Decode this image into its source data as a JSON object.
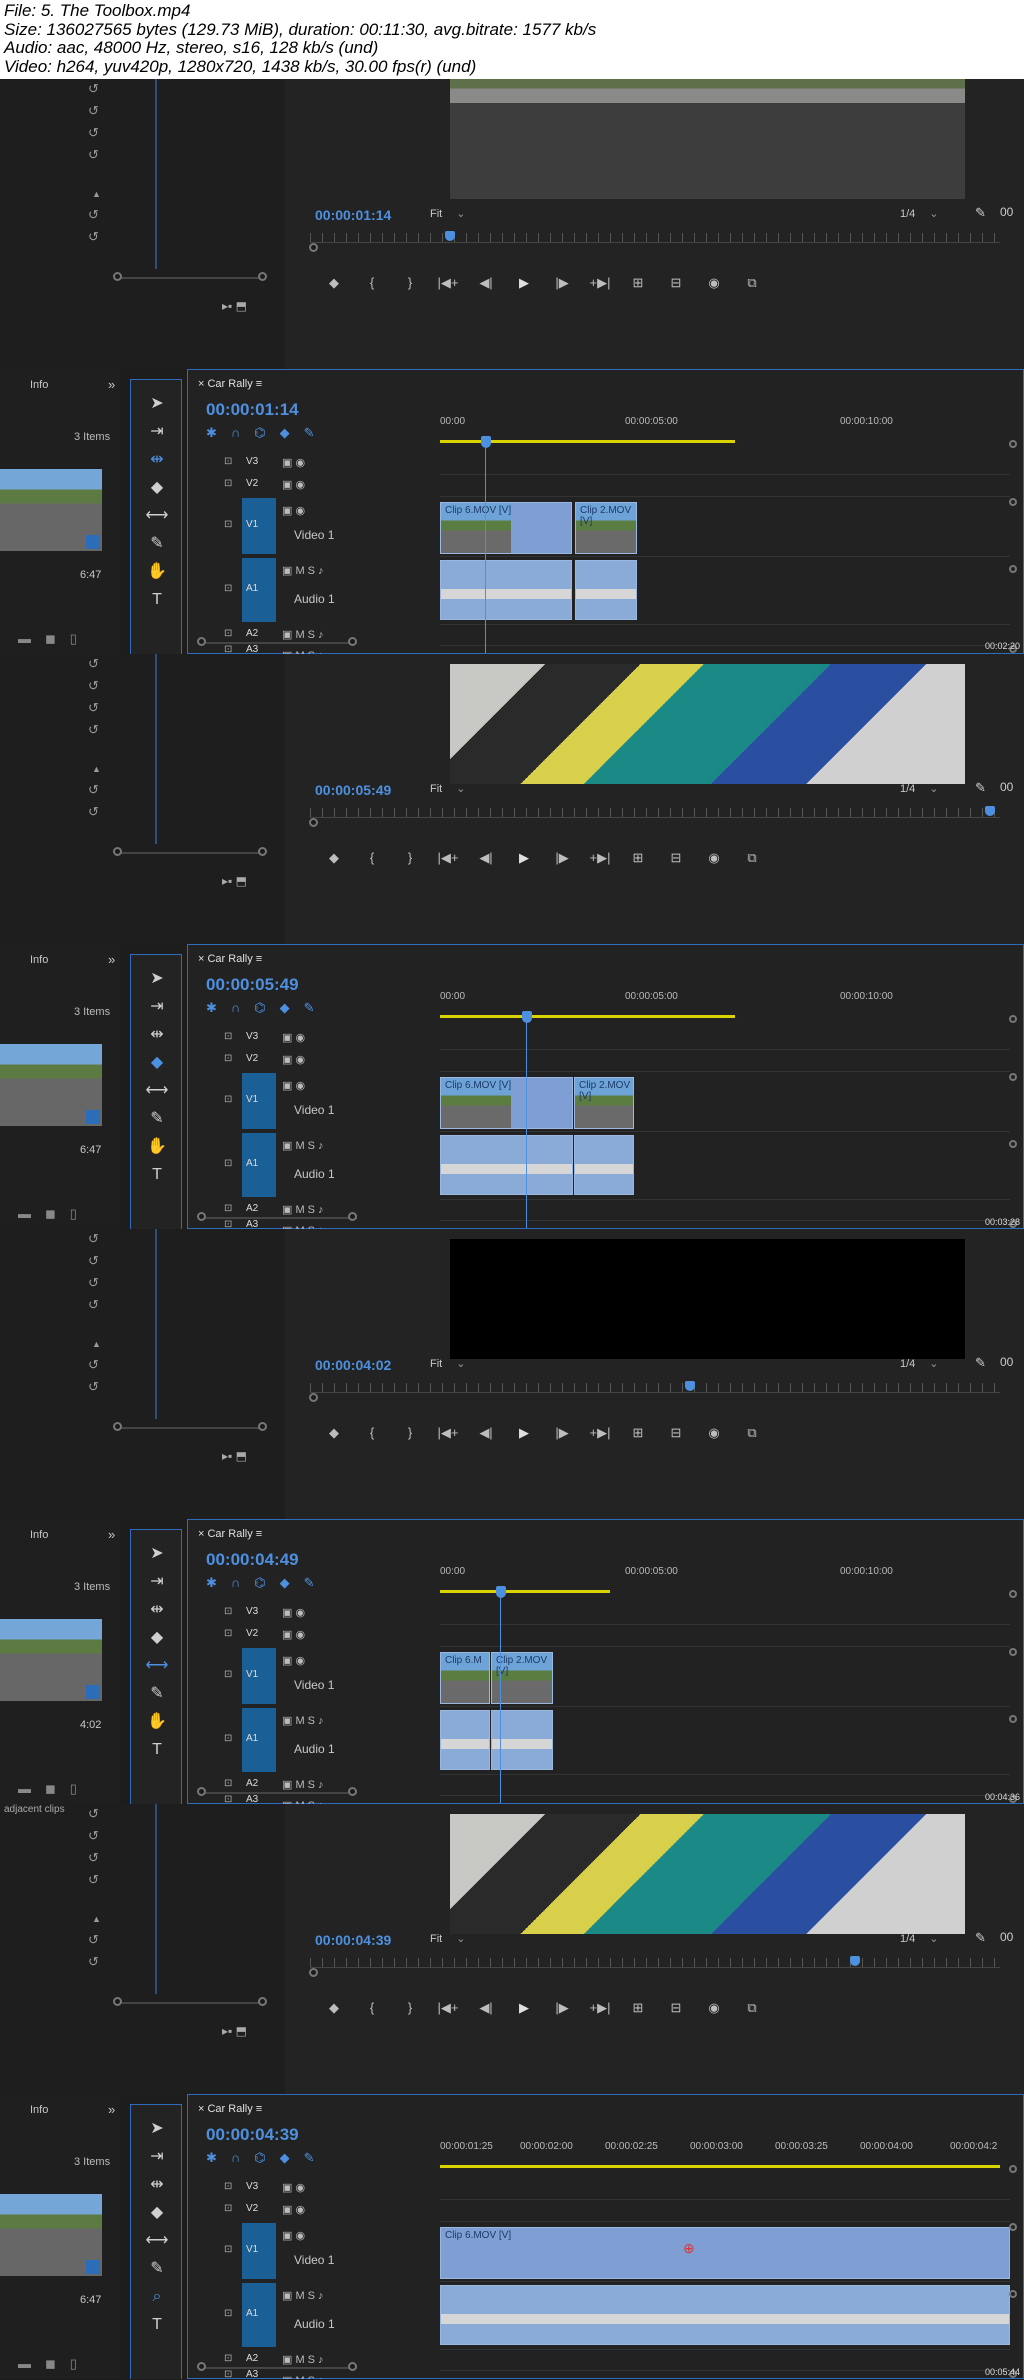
{
  "file_info": {
    "line1": "File: 5. The Toolbox.mp4",
    "line2": "Size: 136027565 bytes (129.73 MiB), duration: 00:11:30, avg.bitrate: 1577 kb/s",
    "line3": "Audio: aac, 48000 Hz, stereo, s16, 128 kb/s (und)",
    "line4": "Video: h264, yuv420p, 1280x720, 1438 kb/s, 30.00 fps(r) (und)"
  },
  "labels": {
    "info": "Info",
    "items": "3 Items",
    "tab": "Car Rally",
    "fit": "Fit",
    "res": "1/4",
    "video1": "Video 1",
    "audio1": "Audio 1",
    "v3": "V3",
    "v2": "V2",
    "v1": "V1",
    "a1": "A1",
    "a2": "A2",
    "a3": "A3",
    "clip6": "Clip 6.MOV [V]",
    "clip2": "Clip 2.MOV [V]",
    "clip6s": "Clip 6.M",
    "clip2s": "Clip 2...",
    "adjacent": "adjacent clips"
  },
  "frames": [
    {
      "monitor_tc": "00:00:01:14",
      "seq_tc": "00:00:01:14",
      "duration": "6:47",
      "ruler": [
        "00:00",
        "00:00:05:00",
        "00:00:10:00"
      ],
      "corner_tc": "00:02:20",
      "selected_tool": "ripple-edit-tool"
    },
    {
      "monitor_tc": "00:00:05:49",
      "seq_tc": "00:00:05:49",
      "duration": "6:47",
      "ruler": [
        "00:00",
        "00:00:05:00",
        "00:00:10:00"
      ],
      "corner_tc": "00:03:28",
      "selected_tool": "razor-tool"
    },
    {
      "monitor_tc": "00:00:04:02",
      "seq_tc": "00:00:04:49",
      "duration": "4:02",
      "ruler": [
        "00:00",
        "00:00:05:00",
        "00:00:10:00"
      ],
      "corner_tc": "00:04:36",
      "selected_tool": "slip-tool"
    },
    {
      "monitor_tc": "00:00:04:39",
      "seq_tc": "00:00:04:39",
      "duration": "6:47",
      "ruler": [
        "00:00:01:25",
        "00:00:02:00",
        "00:00:02:25",
        "00:00:03:00",
        "00:00:03:25",
        "00:00:04:00",
        "00:00:04:2"
      ],
      "corner_tc": "00:05:44",
      "selected_tool": "zoom-tool"
    }
  ],
  "colors": {
    "accent": "#4d90e0",
    "track_blue": "#1a5f96",
    "clip": "#8aaad8",
    "yellow": "#d9d400"
  }
}
